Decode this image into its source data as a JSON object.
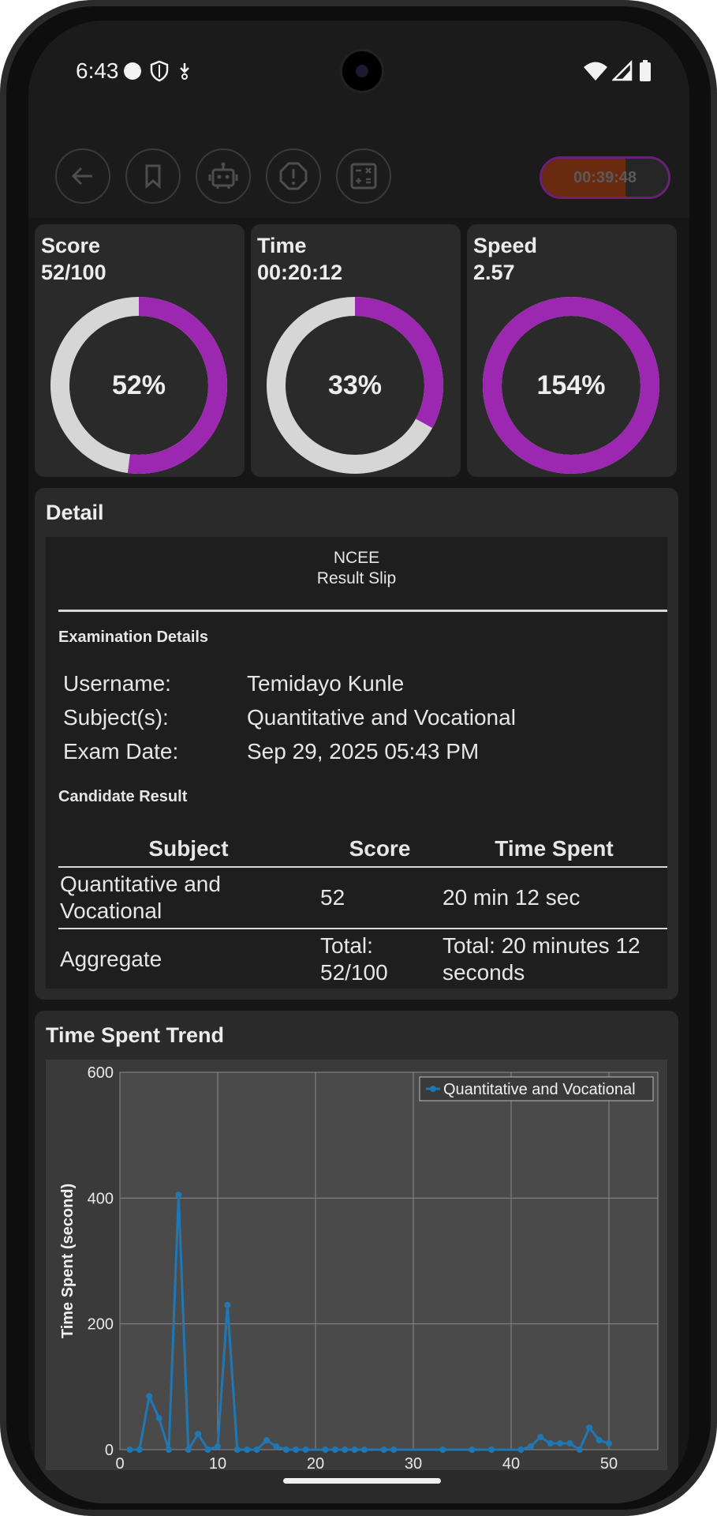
{
  "status_bar": {
    "time": "6:43"
  },
  "toolbar": {
    "buttons": [
      "back",
      "bookmark",
      "assistant",
      "report",
      "calculator"
    ],
    "timer": "00:39:48",
    "timer_progress": 0.66
  },
  "metrics": [
    {
      "label": "Score",
      "value": "52/100",
      "percent_label": "52%",
      "percent": 52
    },
    {
      "label": "Time",
      "value": "00:20:12",
      "percent_label": "33%",
      "percent": 33
    },
    {
      "label": "Speed",
      "value": "2.57",
      "percent_label": "154%",
      "percent": 154
    }
  ],
  "detail": {
    "title": "Detail",
    "slip_header_line1": "NCEE",
    "slip_header_line2": "Result Slip",
    "exam_details_heading": "Examination Details",
    "fields": [
      {
        "key": "Username:",
        "value": "Temidayo Kunle"
      },
      {
        "key": "Subject(s):",
        "value": "Quantitative and Vocational"
      },
      {
        "key": "Exam Date:",
        "value": "Sep 29, 2025 05:43 PM"
      }
    ],
    "candidate_heading": "Candidate Result",
    "table": {
      "headers": [
        "Subject",
        "Score",
        "Time Spent"
      ],
      "rows": [
        [
          "Quantitative and Vocational",
          "52",
          "20 min 12 sec"
        ],
        [
          "Aggregate",
          "Total: 52/100",
          "Total: 20 minutes 12 seconds"
        ]
      ]
    }
  },
  "trend": {
    "title": "Time Spent Trend"
  },
  "chart_data": {
    "type": "line",
    "title": "",
    "xlabel": "",
    "ylabel": "Time Spent (second)",
    "ylim": [
      0,
      600
    ],
    "xlim": [
      0,
      55
    ],
    "y_ticks": [
      "600",
      "400",
      "200",
      "0"
    ],
    "x_ticks": [
      "0",
      "10",
      "20",
      "30",
      "40",
      "50"
    ],
    "grid": true,
    "legend_position": "top-right",
    "series": [
      {
        "name": "Quantitative and Vocational",
        "color": "#1f77b4",
        "x": [
          1,
          2,
          3,
          4,
          5,
          6,
          7,
          8,
          9,
          10,
          11,
          12,
          13,
          14,
          15,
          16,
          17,
          18,
          19,
          21,
          22,
          23,
          24,
          25,
          27,
          28,
          33,
          36,
          38,
          41,
          42,
          43,
          44,
          45,
          46,
          47,
          48,
          49,
          50
        ],
        "y": [
          0,
          0,
          85,
          50,
          0,
          405,
          0,
          25,
          0,
          5,
          230,
          0,
          0,
          0,
          15,
          5,
          0,
          0,
          0,
          0,
          0,
          0,
          0,
          0,
          0,
          0,
          0,
          0,
          0,
          0,
          5,
          20,
          10,
          10,
          10,
          0,
          35,
          15,
          10
        ]
      }
    ]
  }
}
